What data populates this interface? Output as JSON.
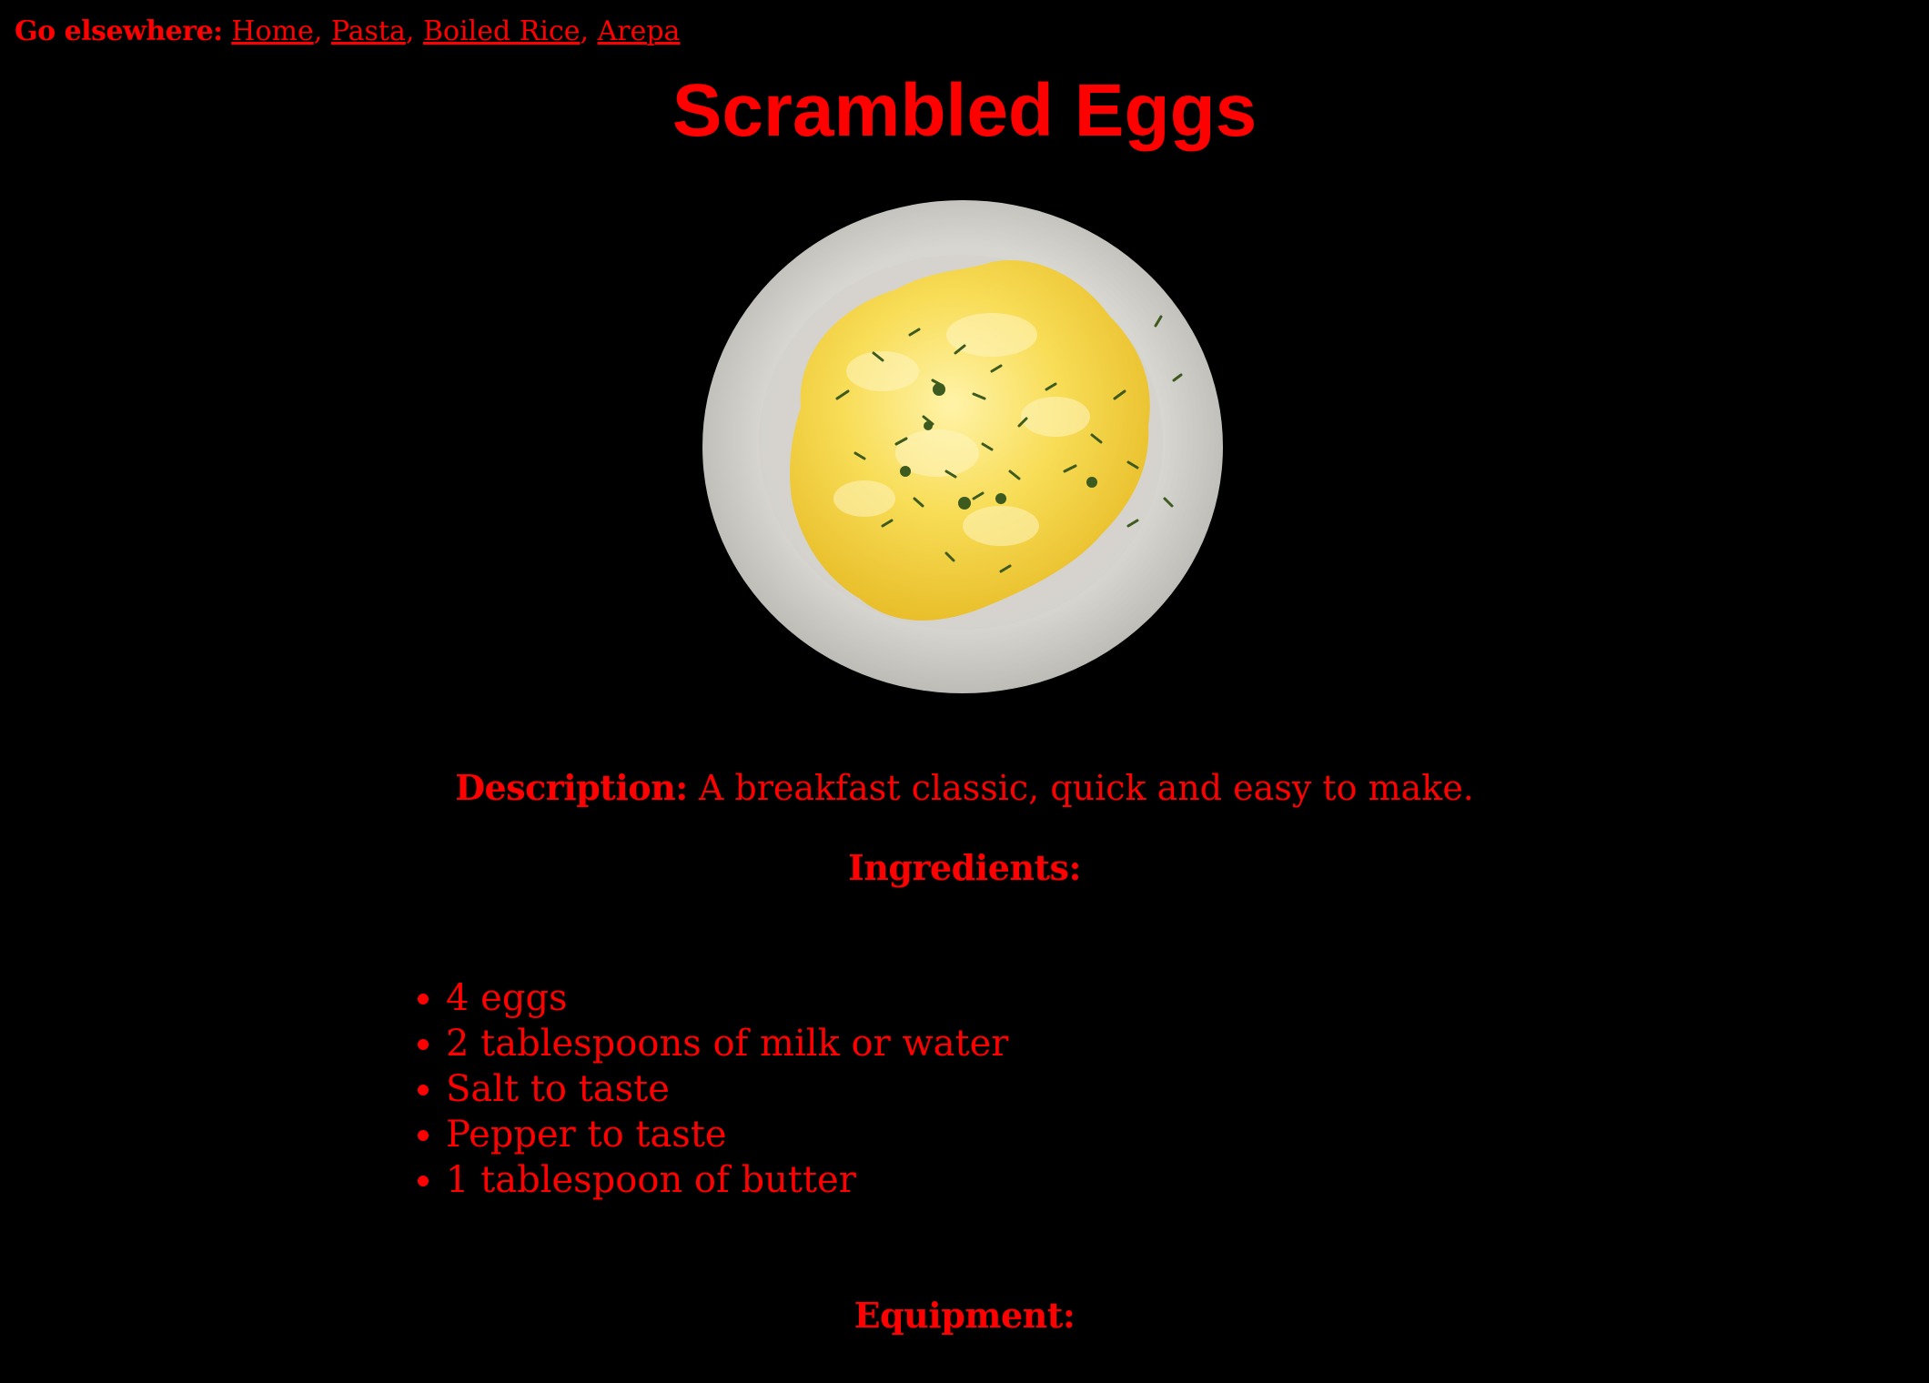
{
  "nav": {
    "label": "Go elsewhere:",
    "links": [
      "Home",
      "Pasta",
      "Boiled Rice",
      "Arepa"
    ],
    "separator": ","
  },
  "page": {
    "title": "Scrambled Eggs"
  },
  "image": {
    "subject": "plate of scrambled eggs with chopped herbs"
  },
  "description": {
    "label": "Description:",
    "text": "A breakfast classic, quick and easy to make."
  },
  "ingredients": {
    "heading": "Ingredients:",
    "items": [
      "4 eggs",
      "2 tablespoons of milk or water",
      "Salt to taste",
      "Pepper to taste",
      "1 tablespoon of butter"
    ]
  },
  "equipment": {
    "heading": "Equipment:"
  },
  "colors": {
    "background": "#000000",
    "text": "#ff0000",
    "plate": "#d9d7d1",
    "eggs": "#f6d53f",
    "herbs": "#3d5a1f"
  }
}
